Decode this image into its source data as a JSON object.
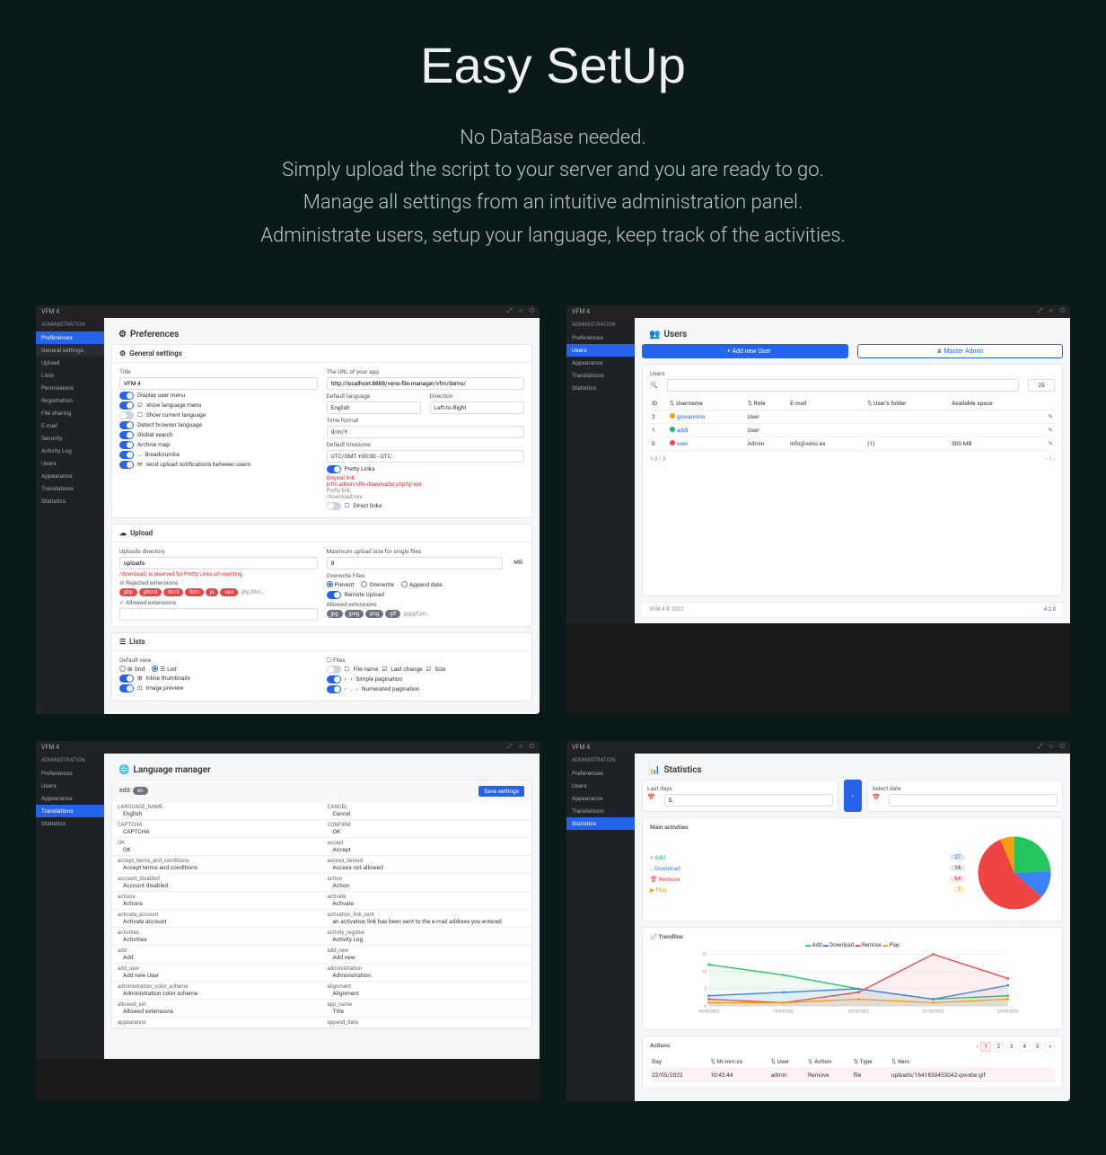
{
  "hero": {
    "title": "Easy SetUp",
    "line1": "No DataBase needed.",
    "line2": "Simply upload the script to your server and you are ready to go.",
    "line3": "Manage all settings from an intuitive administration panel.",
    "line4": "Administrate users, setup your language, keep track of the activities."
  },
  "app": {
    "name": "VFM 4",
    "copyright": "VFM 4 © 2022",
    "version": "4.2.0"
  },
  "nav": {
    "heading": "ADMINISTRATION",
    "items": [
      "Preferences",
      "General settings",
      "Upload",
      "Lists",
      "Permissions",
      "Registration",
      "File sharing",
      "E-mail",
      "Security",
      "Activity Log",
      "Users",
      "Appearance",
      "Translations",
      "Statistics"
    ],
    "short": [
      "Preferences",
      "Users",
      "Appearance",
      "Translations",
      "Statistics"
    ]
  },
  "prefs": {
    "title": "Preferences",
    "general": {
      "heading": "General settings",
      "title_lbl": "Title",
      "title_val": "VFM 4",
      "url_lbl": "The URL of your app",
      "url_val": "http://localhost:8888/veno-file-manager/vfm/demo/",
      "lang_lbl": "Default language",
      "lang_val": "English",
      "dir_lbl": "Direction",
      "dir_val": "Left-to-Right",
      "time_lbl": "Time format",
      "time_val": "d/m/Y",
      "tz_lbl": "Default timezone",
      "tz_val": "UTC/GMT +00:00 - UTC",
      "toggles": [
        "Display user menu",
        "show language menu",
        "Show current language",
        "Detect browser language",
        "Global search",
        "Archive map",
        "Breadcrumbs",
        "send upload notifications between users"
      ],
      "pretty_lbl": "Pretty Links",
      "orig_lbl": "Original link:",
      "orig_val": "{vfm-admin/vfm-downloader.php?q=xxx",
      "pretty_lbl2": "Pretty link:",
      "pretty_val": "/download/xxx",
      "direct_lbl": "Direct links"
    },
    "upload": {
      "heading": "Upload",
      "dir_lbl": "Uploads directory",
      "dir_val": "uploads",
      "warn": "/download/ is reserved for Pretty Links url rewriting",
      "rej_lbl": "Rejected extensions",
      "rej_tags": [
        "php",
        "phtml",
        "html",
        "htm",
        "js",
        "exe"
      ],
      "rej_more": "php,htm…",
      "allow_lbl": "Allowed extensions",
      "max_lbl": "Maximum upload size for single files",
      "max_val": "0",
      "max_unit": "MB",
      "ow_lbl": "Overwrite Files",
      "ow_opts": [
        "Prevent",
        "Overwrite",
        "Append date"
      ],
      "remote_lbl": "Remote Upload",
      "ae_lbl": "Allowed extensions",
      "ae_tags": [
        "jpg",
        "jpeg",
        "png",
        "gif"
      ],
      "ae_more": "jpg,gif,pn…"
    },
    "lists": {
      "heading": "Lists",
      "view_lbl": "Default view",
      "view_opts": [
        "Grid",
        "List"
      ],
      "thumbs": "Inline thumbnails",
      "imgprev": "Image preview",
      "files_lbl": "Files",
      "f1": "File name",
      "f2": "Last change",
      "f3": "Size",
      "pag1": "Simple pagination",
      "pag2": "Numerated pagination"
    }
  },
  "users": {
    "title": "Users",
    "add": "Add new User",
    "master": "Master Admin",
    "search_lbl": "Users",
    "count": "25",
    "cols": [
      "ID",
      "Username",
      "Role",
      "E-mail",
      "User's folder",
      "Available space"
    ],
    "rows": [
      {
        "id": "2",
        "user": "giovannino",
        "role": "User",
        "email": "",
        "folder": "",
        "space": "",
        "c": "#f59e0b"
      },
      {
        "id": "1",
        "user": "addi",
        "role": "User",
        "email": "",
        "folder": "",
        "space": "",
        "c": "#10b981"
      },
      {
        "id": "0",
        "user": "user",
        "role": "Admin",
        "email": "info@veno.es",
        "folder": "(1)",
        "space": "500 MB",
        "c": "#ef4444"
      }
    ],
    "footer": "1-3 / 3"
  },
  "lang": {
    "title": "Language manager",
    "edit": "edit:",
    "code": "en",
    "save": "Save settings",
    "rows": [
      [
        "LANGUAGE_NAME",
        "English",
        "CANCEL",
        "Cancel"
      ],
      [
        "CAPTCHA",
        "CAPTCHA",
        "CONFIRM",
        "OK"
      ],
      [
        "OK",
        "OK",
        "accept",
        "Accept"
      ],
      [
        "accept_terms_and_conditions",
        "Accept terms and conditions",
        "access_denied",
        "Access not allowed"
      ],
      [
        "account_disabled",
        "Account disabled",
        "action",
        "Action"
      ],
      [
        "actions",
        "Actions",
        "activate",
        "Activate"
      ],
      [
        "activate_account",
        "Activate account",
        "activation_link_sent",
        "an activation link has been sent to the e-mail address you entered"
      ],
      [
        "activities",
        "Activities",
        "activity_register",
        "Activity Log"
      ],
      [
        "add",
        "Add",
        "add_new",
        "Add new"
      ],
      [
        "add_user",
        "Add new User",
        "administration",
        "Administration"
      ],
      [
        "administration_color_scheme",
        "Administration color scheme",
        "alignment",
        "Alignment"
      ],
      [
        "allowed_ext",
        "Allowed extensions",
        "app_name",
        "Title"
      ],
      [
        "appearance",
        "",
        "append_date",
        ""
      ]
    ]
  },
  "stats": {
    "title": "Statistics",
    "last_lbl": "Last days",
    "last_val": "5",
    "sel_lbl": "Select date",
    "main_lbl": "Main activities",
    "acts": [
      {
        "n": "Add",
        "c": "27",
        "cls": "b"
      },
      {
        "n": "Download",
        "c": "14",
        "cls": ""
      },
      {
        "n": "Remove",
        "c": "64",
        "cls": "r"
      },
      {
        "n": "Play",
        "c": "7",
        "cls": "y"
      }
    ],
    "trend_lbl": "Trendline",
    "legend": [
      "Add",
      "Download",
      "Remove",
      "Play"
    ],
    "actions_lbl": "Actions",
    "pages": [
      "1",
      "2",
      "3",
      "4",
      "5",
      "»"
    ],
    "tbl_cols": [
      "Day",
      "hh:mm:ss",
      "User",
      "Action",
      "Type",
      "Item"
    ],
    "tbl_row": [
      "22/05/2022",
      "10:43:44",
      "admin",
      "Remove",
      "file",
      "uploads/1641830453042-qxvxbe.gif"
    ]
  },
  "chart_data": [
    {
      "type": "pie",
      "title": "Main activities",
      "series": [
        {
          "name": "Add",
          "value": 27,
          "color": "#22c55e"
        },
        {
          "name": "Download",
          "value": 14,
          "color": "#3b82f6"
        },
        {
          "name": "Remove",
          "value": 64,
          "color": "#ef4444"
        },
        {
          "name": "Play",
          "value": 7,
          "color": "#f59e0b"
        }
      ]
    },
    {
      "type": "line",
      "title": "Trendline",
      "x": [
        "18/05/2022",
        "19/05/2022",
        "20/05/2022",
        "21/05/2022",
        "22/05/2022"
      ],
      "series": [
        {
          "name": "Add",
          "color": "#22c55e",
          "values": [
            12,
            9,
            5,
            2,
            3
          ]
        },
        {
          "name": "Download",
          "color": "#3b82f6",
          "values": [
            3,
            4,
            5,
            2,
            6
          ]
        },
        {
          "name": "Remove",
          "color": "#ef4444",
          "values": [
            2,
            1,
            4,
            15,
            8
          ]
        },
        {
          "name": "Play",
          "color": "#f59e0b",
          "values": [
            1,
            1,
            2,
            1,
            2
          ]
        }
      ],
      "ylim": [
        0,
        15
      ]
    }
  ]
}
